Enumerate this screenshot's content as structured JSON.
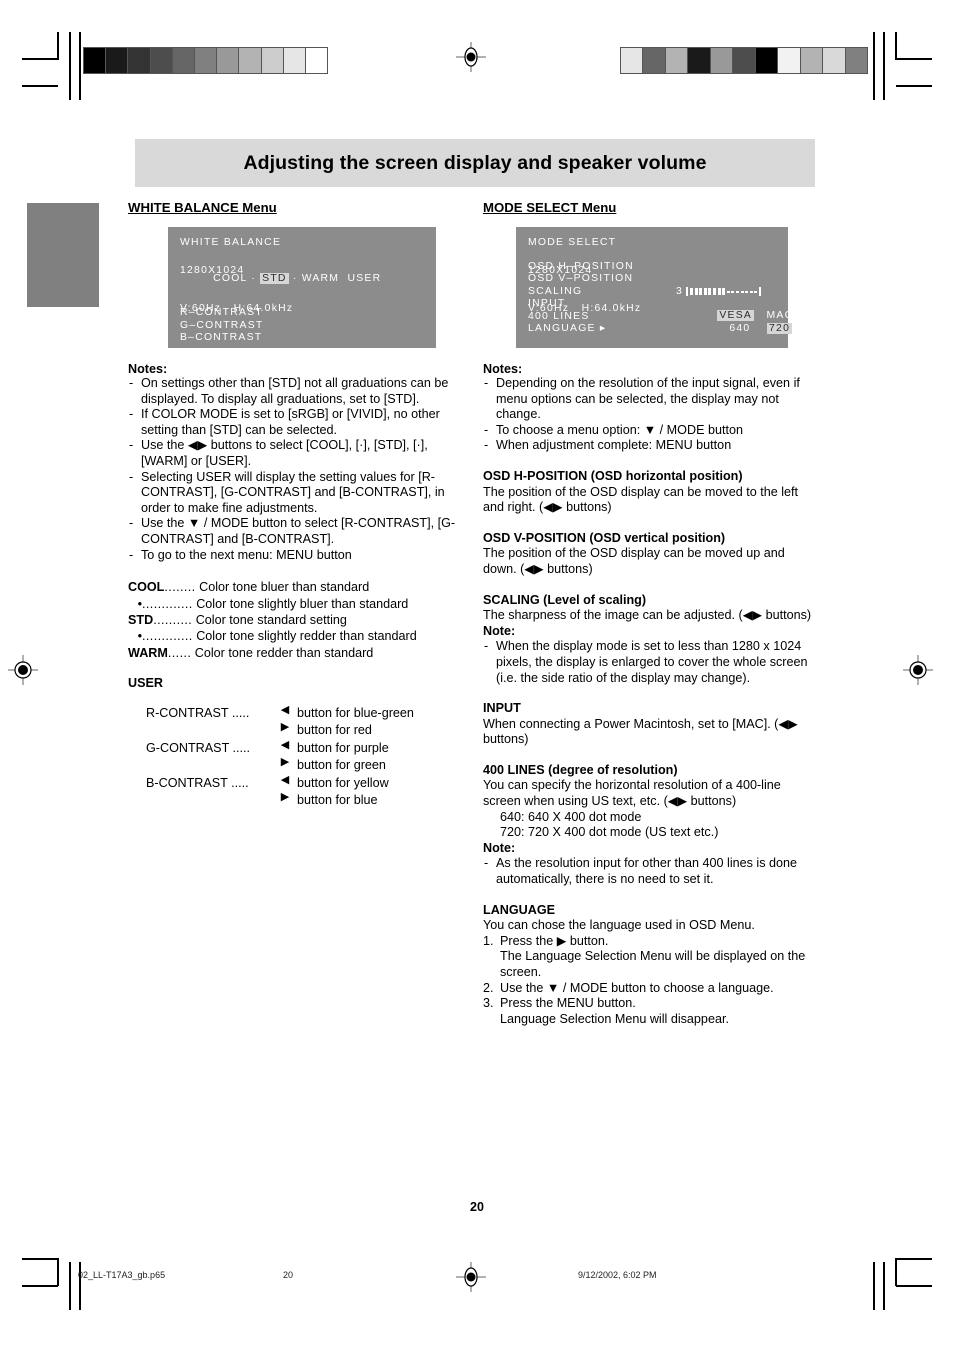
{
  "document": {
    "title": "Adjusting the screen display and speaker volume",
    "page_number": "20"
  },
  "footer": {
    "file_name": "02_LL-T17A3_gb.p65",
    "page": "20",
    "timestamp": "9/12/2002, 6:02 PM"
  },
  "left_column": {
    "heading": "WHITE BALANCE Menu",
    "osd": {
      "title": "WHITE BALANCE",
      "options_prefix": "COOL",
      "options_sep1": " · ",
      "selected_option": "STD",
      "options_sep2": " · ",
      "options_mid": "WARM",
      "options_last": "USER",
      "items": [
        "R–CONTRAST",
        "G–CONTRAST",
        "B–CONTRAST"
      ],
      "footer_line1": "1280X1024",
      "footer_line2": "V:60Hz   H:64.0kHz"
    },
    "notes_label": "Notes:",
    "notes": [
      "On settings other than [STD] not all graduations can be displayed. To display all graduations, set to [STD].",
      "If COLOR MODE is set to [sRGB] or [VIVID], no other setting than [STD] can be selected.",
      "Use the ◀▶ buttons to select [COOL], [·], [STD], [·], [WARM] or [USER].",
      "Selecting USER will display the setting values for [R-CONTRAST], [G-CONTRAST] and [B-CONTRAST], in order to make fine adjustments.",
      "Use the ▼ / MODE button to select [R-CONTRAST], [G-CONTRAST] and [B-CONTRAST].",
      "To go to the next menu: MENU button"
    ],
    "definitions": [
      {
        "term": "COOL",
        "bullet": false,
        "dots": "........",
        "desc": "Color tone bluer than standard"
      },
      {
        "term": "•",
        "bullet": true,
        "dots": ".............",
        "desc": "Color tone slightly bluer than standard"
      },
      {
        "term": "STD",
        "bullet": false,
        "dots": "..........",
        "desc": "Color tone standard setting"
      },
      {
        "term": "•",
        "bullet": true,
        "dots": ".............",
        "desc": "Color tone slightly redder than standard"
      },
      {
        "term": "WARM",
        "bullet": false,
        "dots": "......",
        "desc": "Color tone redder than standard"
      }
    ],
    "user_heading": "USER",
    "user_rows": [
      {
        "label": "R-CONTRAST .....",
        "arrow": "◀",
        "desc": "button for blue-green"
      },
      {
        "label": "",
        "arrow": "▶",
        "desc": "button for red"
      },
      {
        "label": "G-CONTRAST .....",
        "arrow": "◀",
        "desc": "button for purple"
      },
      {
        "label": "",
        "arrow": "▶",
        "desc": "button for green"
      },
      {
        "label": "B-CONTRAST .....",
        "arrow": "◀",
        "desc": "button for yellow"
      },
      {
        "label": "",
        "arrow": "▶",
        "desc": "button for blue"
      }
    ]
  },
  "right_column": {
    "heading": "MODE SELECT Menu",
    "osd": {
      "title": "MODE SELECT",
      "items": [
        "OSD H–POSITION",
        "OSD V–POSITION",
        "SCALING",
        "INPUT",
        "400 LINES",
        "LANGUAGE ▸"
      ],
      "scaling_value": "3",
      "scaling_filled_segments": 8,
      "scaling_empty_segments": 7,
      "input_options": {
        "left": "VESA",
        "right": "MAC",
        "selected": "VESA"
      },
      "lines_options": {
        "left": "640",
        "right": "720",
        "selected": "720"
      },
      "footer_line1": "1280X1024",
      "footer_line2": "V:60Hz   H:64.0kHz"
    },
    "notes_label": "Notes:",
    "notes": [
      "Depending on the resolution of the input signal, even if menu options can be selected, the display may not change.",
      "To choose a menu option: ▼ / MODE button",
      "When adjustment complete: MENU button"
    ],
    "sections": [
      {
        "heading": "OSD H-POSITION (OSD horizontal position)",
        "body": "The position of the OSD display can be moved to the left and right. (◀▶ buttons)"
      },
      {
        "heading": "OSD V-POSITION (OSD vertical position)",
        "body": "The position of the OSD display can be moved up and down. (◀▶ buttons)"
      }
    ],
    "scaling": {
      "heading": "SCALING (Level of scaling)",
      "body": "The sharpness of the image can be adjusted.  (◀▶ buttons)",
      "note_label": "Note:",
      "notes": [
        "When the display mode is set to less than 1280 x 1024 pixels, the display is enlarged to cover the whole screen (i.e. the side ratio of the display may change)."
      ]
    },
    "input": {
      "heading": "INPUT",
      "body": "When connecting a Power Macintosh, set to [MAC]. (◀▶ buttons)"
    },
    "lines400": {
      "heading": "400 LINES (degree of resolution)",
      "body": "You can specify the horizontal resolution of a 400-line screen when using US text, etc. (◀▶ buttons)",
      "sub_items": [
        "640: 640 X 400 dot mode",
        "720: 720 X 400 dot mode (US text etc.)"
      ],
      "note_label": "Note:",
      "notes": [
        "As the resolution input for other than 400 lines is done automatically, there is no need to set it."
      ]
    },
    "language": {
      "heading": "LANGUAGE",
      "body": "You can chose the language used in OSD Menu.",
      "steps": [
        {
          "text": "Press the ▶ button.",
          "sub": "The Language Selection Menu will be displayed on the screen."
        },
        {
          "text": "Use the ▼ / MODE button to choose a language.",
          "sub": ""
        },
        {
          "text": "Press the MENU button.",
          "sub": "Language Selection Menu will disappear."
        }
      ]
    }
  },
  "print_marks": {
    "colorbar_left": [
      "#000000",
      "#1a1a1a",
      "#333333",
      "#4d4d4d",
      "#666666",
      "#808080",
      "#999999",
      "#b3b3b3",
      "#cccccc",
      "#e6e6e6",
      "#ffffff"
    ],
    "colorbar_right": [
      "#e6e6e6",
      "#666666",
      "#b3b3b3",
      "#1a1a1a",
      "#999999",
      "#4d4d4d",
      "#000000",
      "#f2f2f2",
      "#b3b3b3",
      "#d9d9d9",
      "#808080"
    ],
    "side_tab_color": "#808080"
  }
}
